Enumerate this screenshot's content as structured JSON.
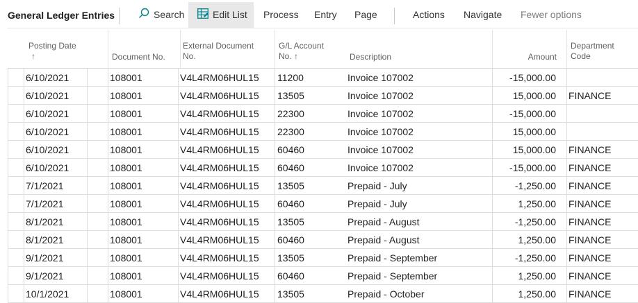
{
  "toolbar": {
    "title": "General Ledger Entries",
    "search": "Search",
    "edit_list": "Edit List",
    "process": "Process",
    "entry": "Entry",
    "page": "Page",
    "actions": "Actions",
    "navigate": "Navigate",
    "fewer_options": "Fewer options",
    "accent_color": "#00838f"
  },
  "table": {
    "headers": {
      "posting_date": "Posting Date",
      "posting_date_sort": "↑",
      "document_no": "Document No.",
      "external_doc_1": "External Document",
      "external_doc_2": "No.",
      "gl_account_1": "G/L Account",
      "gl_account_2": "No. ↑",
      "description": "Description",
      "amount": "Amount",
      "department_1": "Department",
      "department_2": "Code"
    },
    "rows": [
      {
        "posting_date": "6/10/2021",
        "document_no": "108001",
        "external_doc": "V4L4RM06HUL15",
        "gl_account": "11200",
        "description": "Invoice 107002",
        "amount": "-15,000.00",
        "department": ""
      },
      {
        "posting_date": "6/10/2021",
        "document_no": "108001",
        "external_doc": "V4L4RM06HUL15",
        "gl_account": "13505",
        "description": "Invoice 107002",
        "amount": "15,000.00",
        "department": "FINANCE"
      },
      {
        "posting_date": "6/10/2021",
        "document_no": "108001",
        "external_doc": "V4L4RM06HUL15",
        "gl_account": "22300",
        "description": "Invoice 107002",
        "amount": "-15,000.00",
        "department": ""
      },
      {
        "posting_date": "6/10/2021",
        "document_no": "108001",
        "external_doc": "V4L4RM06HUL15",
        "gl_account": "22300",
        "description": "Invoice 107002",
        "amount": "15,000.00",
        "department": ""
      },
      {
        "posting_date": "6/10/2021",
        "document_no": "108001",
        "external_doc": "V4L4RM06HUL15",
        "gl_account": "60460",
        "description": "Invoice 107002",
        "amount": "15,000.00",
        "department": "FINANCE"
      },
      {
        "posting_date": "6/10/2021",
        "document_no": "108001",
        "external_doc": "V4L4RM06HUL15",
        "gl_account": "60460",
        "description": "Invoice 107002",
        "amount": "-15,000.00",
        "department": "FINANCE"
      },
      {
        "posting_date": "7/1/2021",
        "document_no": "108001",
        "external_doc": "V4L4RM06HUL15",
        "gl_account": "13505",
        "description": "Prepaid - July",
        "amount": "-1,250.00",
        "department": "FINANCE"
      },
      {
        "posting_date": "7/1/2021",
        "document_no": "108001",
        "external_doc": "V4L4RM06HUL15",
        "gl_account": "60460",
        "description": "Prepaid - July",
        "amount": "1,250.00",
        "department": "FINANCE"
      },
      {
        "posting_date": "8/1/2021",
        "document_no": "108001",
        "external_doc": "V4L4RM06HUL15",
        "gl_account": "13505",
        "description": "Prepaid - August",
        "amount": "-1,250.00",
        "department": "FINANCE"
      },
      {
        "posting_date": "8/1/2021",
        "document_no": "108001",
        "external_doc": "V4L4RM06HUL15",
        "gl_account": "60460",
        "description": "Prepaid - August",
        "amount": "1,250.00",
        "department": "FINANCE"
      },
      {
        "posting_date": "9/1/2021",
        "document_no": "108001",
        "external_doc": "V4L4RM06HUL15",
        "gl_account": "13505",
        "description": "Prepaid - September",
        "amount": "-1,250.00",
        "department": "FINANCE"
      },
      {
        "posting_date": "9/1/2021",
        "document_no": "108001",
        "external_doc": "V4L4RM06HUL15",
        "gl_account": "60460",
        "description": "Prepaid - September",
        "amount": "1,250.00",
        "department": "FINANCE"
      },
      {
        "posting_date": "10/1/2021",
        "document_no": "108001",
        "external_doc": "V4L4RM06HUL15",
        "gl_account": "13505",
        "description": "Prepaid - October",
        "amount": "1,250.00",
        "department": "FINANCE"
      }
    ]
  }
}
